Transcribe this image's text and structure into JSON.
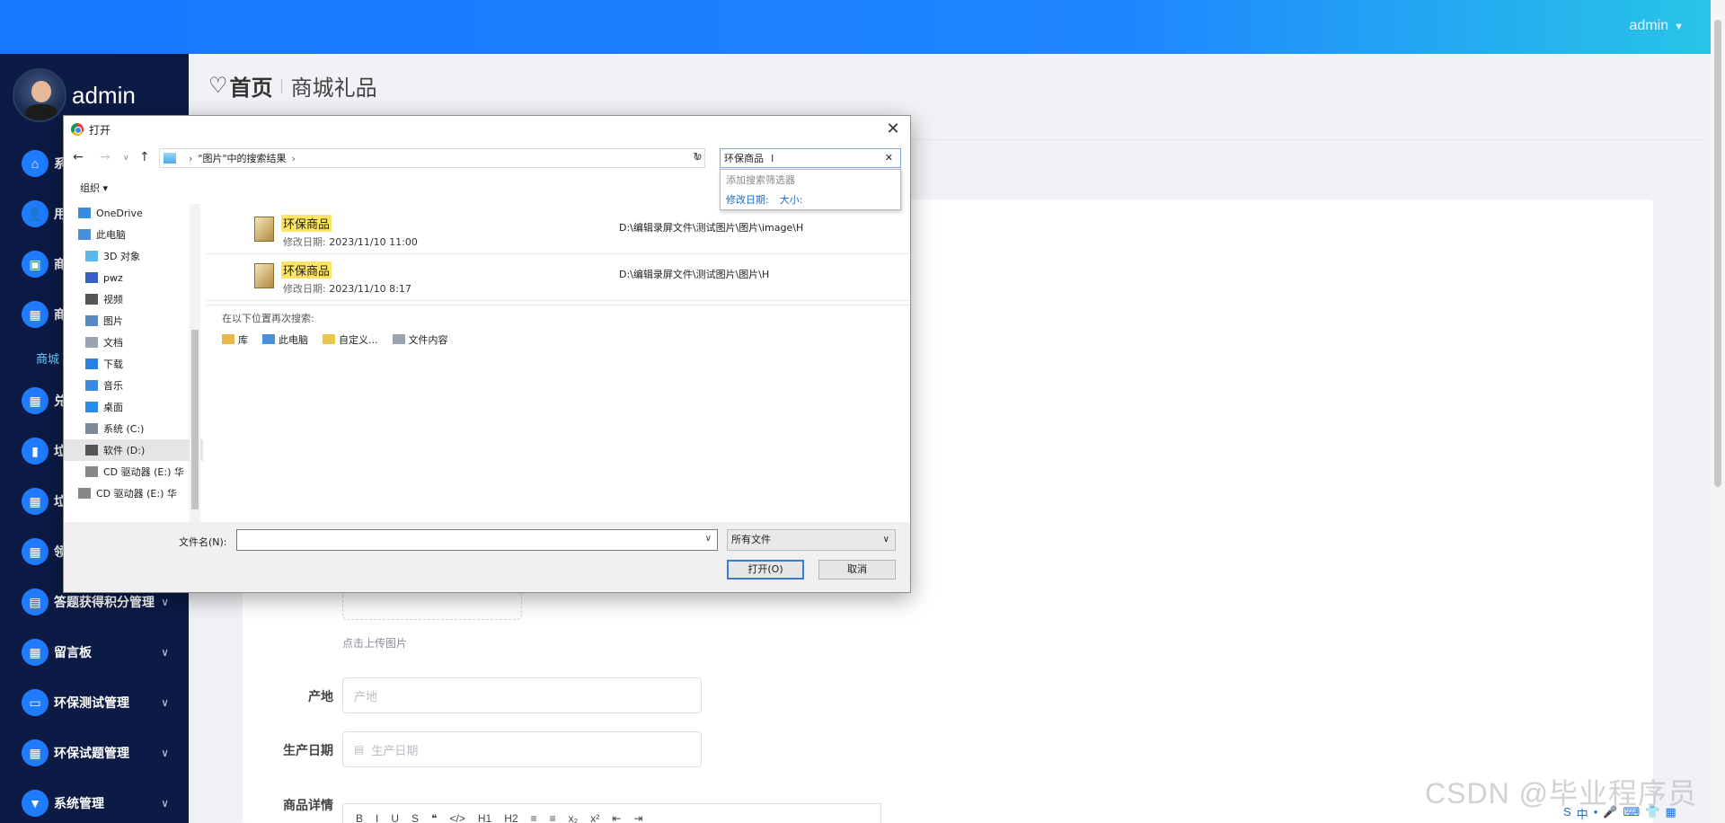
{
  "header": {
    "user": "admin",
    "caret": "▼"
  },
  "sidebar": {
    "username": "admin",
    "items": [
      {
        "label": "系",
        "icon": "home-icon",
        "glyph": "⌂"
      },
      {
        "label": "用",
        "icon": "user-icon",
        "glyph": "👤"
      },
      {
        "label": "商",
        "icon": "briefcase-icon",
        "glyph": "▣"
      },
      {
        "label": "商",
        "icon": "grid-icon",
        "glyph": "▦"
      },
      {
        "label": "兑",
        "icon": "grid-icon",
        "glyph": "▦"
      },
      {
        "label": "垃",
        "icon": "bar-chart-icon",
        "glyph": "▮"
      },
      {
        "label": "垃",
        "icon": "grid-icon",
        "glyph": "▦"
      },
      {
        "label": "领",
        "icon": "grid-icon",
        "glyph": "▦"
      },
      {
        "label": "答题获得积分管理",
        "icon": "clipboard-icon",
        "glyph": "▤"
      },
      {
        "label": "留言板",
        "icon": "grid-icon",
        "glyph": "▦"
      },
      {
        "label": "环保测试管理",
        "icon": "monitor-icon",
        "glyph": "▭"
      },
      {
        "label": "环保试题管理",
        "icon": "grid-icon",
        "glyph": "▦"
      },
      {
        "label": "系统管理",
        "icon": "pin-icon",
        "glyph": "▼"
      }
    ],
    "active_sub": "商城"
  },
  "breadcrumb": {
    "home": "首页",
    "separator": "|",
    "current": "商城礼品"
  },
  "form": {
    "upload_tip": "点击上传图片",
    "origin_label": "产地",
    "origin_placeholder": "产地",
    "date_label": "生产日期",
    "date_placeholder": "生产日期",
    "detail_label": "商品详情",
    "editor_tools": [
      "B",
      "I",
      "U",
      "S",
      "❝",
      "</>",
      "H1",
      "H2",
      "≡",
      "≡",
      "x₂",
      "x²",
      "⇤",
      "⇥"
    ]
  },
  "dialog": {
    "title": "打开",
    "close": "✕",
    "address": {
      "crumb": "\"图片\"中的搜索结果"
    },
    "search_text": "环保商品",
    "suggest": {
      "hint": "添加搜索筛选器",
      "filter_date": "修改日期:",
      "filter_size": "大小:"
    },
    "organize": "组织 ▾",
    "nav": [
      {
        "label": "OneDrive",
        "indent": 16,
        "color": "#3a8be0"
      },
      {
        "label": "此电脑",
        "indent": 16,
        "color": "#4a90d9"
      },
      {
        "label": "3D 对象",
        "indent": 24,
        "color": "#5bb8e8"
      },
      {
        "label": "pwz",
        "indent": 24,
        "color": "#3a5fc4"
      },
      {
        "label": "视频",
        "indent": 24,
        "color": "#555555"
      },
      {
        "label": "图片",
        "indent": 24,
        "color": "#5a88c0"
      },
      {
        "label": "文档",
        "indent": 24,
        "color": "#9aa4b0"
      },
      {
        "label": "下载",
        "indent": 24,
        "color": "#2a7fe0"
      },
      {
        "label": "音乐",
        "indent": 24,
        "color": "#3a8be0"
      },
      {
        "label": "桌面",
        "indent": 24,
        "color": "#2a8ae8"
      },
      {
        "label": "系统 (C:)",
        "indent": 24,
        "color": "#7a8a9a"
      },
      {
        "label": "软件 (D:)",
        "indent": 24,
        "color": "#555555",
        "selected": true
      },
      {
        "label": "CD 驱动器 (E:) 华",
        "indent": 24,
        "color": "#888888"
      },
      {
        "label": "CD 驱动器 (E:) 华",
        "indent": 16,
        "color": "#888888"
      }
    ],
    "results": [
      {
        "name": "环保商品",
        "date_label": "修改日期:",
        "date": "2023/11/10 11:00",
        "path": "D:\\编辑录屏文件\\测试图片\\图片\\image\\H"
      },
      {
        "name": "环保商品",
        "date_label": "修改日期:",
        "date": "2023/11/10 8:17",
        "path": "D:\\编辑录屏文件\\测试图片\\图片\\H"
      }
    ],
    "search_again": {
      "heading": "在以下位置再次搜索:",
      "links": [
        "库",
        "此电脑",
        "自定义...",
        "文件内容"
      ]
    },
    "filename_label": "文件名(N):",
    "filename_value": "",
    "filetype": "所有文件",
    "open_label": "打开(O)",
    "cancel_label": "取消"
  },
  "watermark": "CSDN @毕业程序员",
  "tray": [
    "S",
    "中",
    "•",
    "🎤",
    "⌨",
    "👕",
    "▦"
  ]
}
